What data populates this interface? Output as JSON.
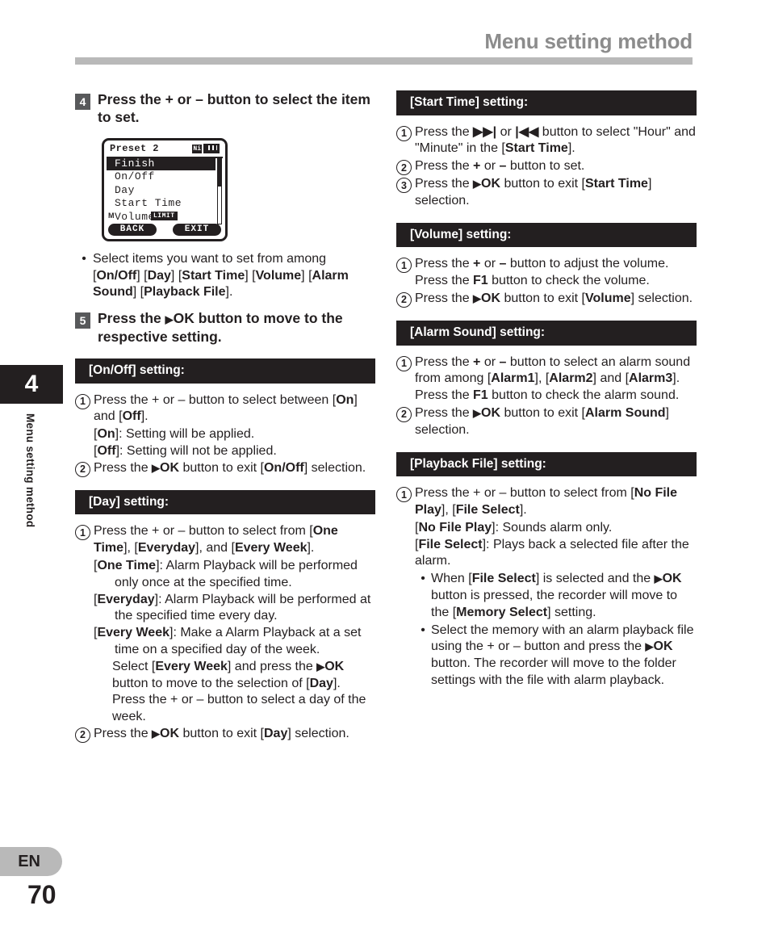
{
  "header": {
    "title": "Menu setting method"
  },
  "sidebar": {
    "chapter_number": "4",
    "vertical_label": "Menu setting method",
    "language_tab": "EN",
    "page_number": "70"
  },
  "left_column": {
    "step4": {
      "number": "4",
      "text": "Press the + or – button to select the item to set."
    },
    "lcd": {
      "title": "Preset 2",
      "battery_label": "Ni",
      "items": [
        "Finish",
        "On/Off",
        "Day",
        "Start Time",
        "Volume"
      ],
      "selected_index": 0,
      "mic_icon_label": "M",
      "limit_badge": "LIMIT",
      "button_left": "BACK",
      "button_right": "EXIT"
    },
    "bullet1": {
      "dot": "•",
      "prefix": "Select items you want to set from among [",
      "b1": "On/Off",
      "s1": "] [",
      "b2": "Day",
      "s2": "] [",
      "b3": "Start Time",
      "s3": "] [",
      "b4": "Volume",
      "s4": "] [",
      "b5": "Alarm Sound",
      "s5": "] [",
      "b6": "Playback File",
      "s6": "]."
    },
    "step5": {
      "number": "5",
      "text_a": "Press the ",
      "triangle": "▶",
      "text_b": "OK button to move to the respective setting."
    },
    "onoff": {
      "heading_a": "[",
      "heading_b": "On/Off",
      "heading_c": "] setting:",
      "s1_num": "1",
      "s1_a": "Press the + or – button to select between [",
      "s1_b": "On",
      "s1_c": "] and [",
      "s1_d": "Off",
      "s1_e": "].",
      "l1_a": "[",
      "l1_b": "On",
      "l1_c": "]: Setting will be applied.",
      "l2_a": "[",
      "l2_b": "Off",
      "l2_c": "]: Setting will not be applied.",
      "s2_num": "2",
      "s2_a": "Press the ",
      "s2_tri": "▶",
      "s2_b": "OK",
      "s2_c": " button to exit [",
      "s2_d": "On/Off",
      "s2_e": "] selection."
    },
    "day": {
      "heading_a": "[",
      "heading_b": "Day",
      "heading_c": "] setting:",
      "s1_num": "1",
      "s1_a": "Press the + or – button to select from [",
      "s1_b": "One Time",
      "s1_c": "], [",
      "s1_d": "Everyday",
      "s1_e": "], and [",
      "s1_f": "Every Week",
      "s1_g": "].",
      "d1_a": "[",
      "d1_b": "One Time",
      "d1_c": "]: Alarm Playback will be performed only once at the specified time.",
      "d2_a": "[",
      "d2_b": "Everyday",
      "d2_c": "]: Alarm Playback will be performed at the specified time every day.",
      "d3_a": "[",
      "d3_b": "Every Week",
      "d3_c": "]: Make a Alarm Playback at a set time on a specified day of the week.",
      "d4_a": "Select [",
      "d4_b": "Every Week",
      "d4_c": "] and press the ",
      "d4_tri": "▶",
      "d4_d": "OK",
      "d4_e": " button to move to the selection of [",
      "d4_f": "Day",
      "d4_g": "]. Press the + or – button to select a day of the week.",
      "s2_num": "2",
      "s2_a": "Press the ",
      "s2_tri": "▶",
      "s2_b": "OK",
      "s2_c": " button to exit [",
      "s2_d": "Day",
      "s2_e": "] selection."
    }
  },
  "right_column": {
    "start_time": {
      "heading_a": "[",
      "heading_b": "Start Time",
      "heading_c": "] setting:",
      "s1_num": "1",
      "s1_a": "Press the ",
      "s1_ff": "▶▶|",
      "s1_b": " or ",
      "s1_rw": "|◀◀",
      "s1_c": " button to select \"Hour\" and \"Minute\" in the [",
      "s1_d": "Start Time",
      "s1_e": "].",
      "s2_num": "2",
      "s2_a": "Press the ",
      "s2_b": "+",
      "s2_c": " or ",
      "s2_d": "–",
      "s2_e": " button to set.",
      "s3_num": "3",
      "s3_a": "Press the ",
      "s3_tri": "▶",
      "s3_b": "OK",
      "s3_c": " button to exit [",
      "s3_d": "Start Time",
      "s3_e": "] selection."
    },
    "volume": {
      "heading_a": "[",
      "heading_b": "Volume",
      "heading_c": "] setting:",
      "s1_num": "1",
      "s1_a": "Press the ",
      "s1_b": "+",
      "s1_c": " or ",
      "s1_d": "–",
      "s1_e": " button to adjust the volume. Press the ",
      "s1_f": "F1",
      "s1_g": " button to check the volume.",
      "s2_num": "2",
      "s2_a": "Press the ",
      "s2_tri": "▶",
      "s2_b": "OK",
      "s2_c": " button to exit [",
      "s2_d": "Volume",
      "s2_e": "] selection."
    },
    "alarm_sound": {
      "heading_a": "[",
      "heading_b": "Alarm Sound",
      "heading_c": "] setting:",
      "s1_num": "1",
      "s1_a": "Press the ",
      "s1_b": "+",
      "s1_c": " or ",
      "s1_d": "–",
      "s1_e": " button to select an alarm sound from among [",
      "s1_f": "Alarm1",
      "s1_g": "], [",
      "s1_h": "Alarm2",
      "s1_i": "] and [",
      "s1_j": "Alarm3",
      "s1_k": "]. Press the ",
      "s1_l": "F1",
      "s1_m": " button to check the alarm sound.",
      "s2_num": "2",
      "s2_a": "Press the ",
      "s2_tri": "▶",
      "s2_b": "OK",
      "s2_c": " button to exit [",
      "s2_d": "Alarm Sound",
      "s2_e": "] selection."
    },
    "playback_file": {
      "heading_a": "[",
      "heading_b": "Playback File",
      "heading_c": "] setting:",
      "s1_num": "1",
      "s1_a": "Press the + or – button to select from [",
      "s1_b": "No File Play",
      "s1_c": "], [",
      "s1_d": "File Select",
      "s1_e": "].",
      "p1_a": "[",
      "p1_b": "No File Play",
      "p1_c": "]: Sounds alarm only.",
      "p2_a": "[",
      "p2_b": "File Select",
      "p2_c": "]: Plays back a selected file after the alarm.",
      "b1_dot": "•",
      "b1_a": "When [",
      "b1_b": "File Select",
      "b1_c": "] is selected and the ",
      "b1_tri": "▶",
      "b1_d": "OK",
      "b1_e": " button is pressed, the recorder will move to the [",
      "b1_f": "Memory Select",
      "b1_g": "] setting.",
      "b2_dot": "•",
      "b2_a": "Select the memory with an alarm playback file using the + or – button and press the ",
      "b2_tri": "▶",
      "b2_b": "OK",
      "b2_c": " button. The recorder will move to the folder settings with the file with alarm playback."
    }
  }
}
